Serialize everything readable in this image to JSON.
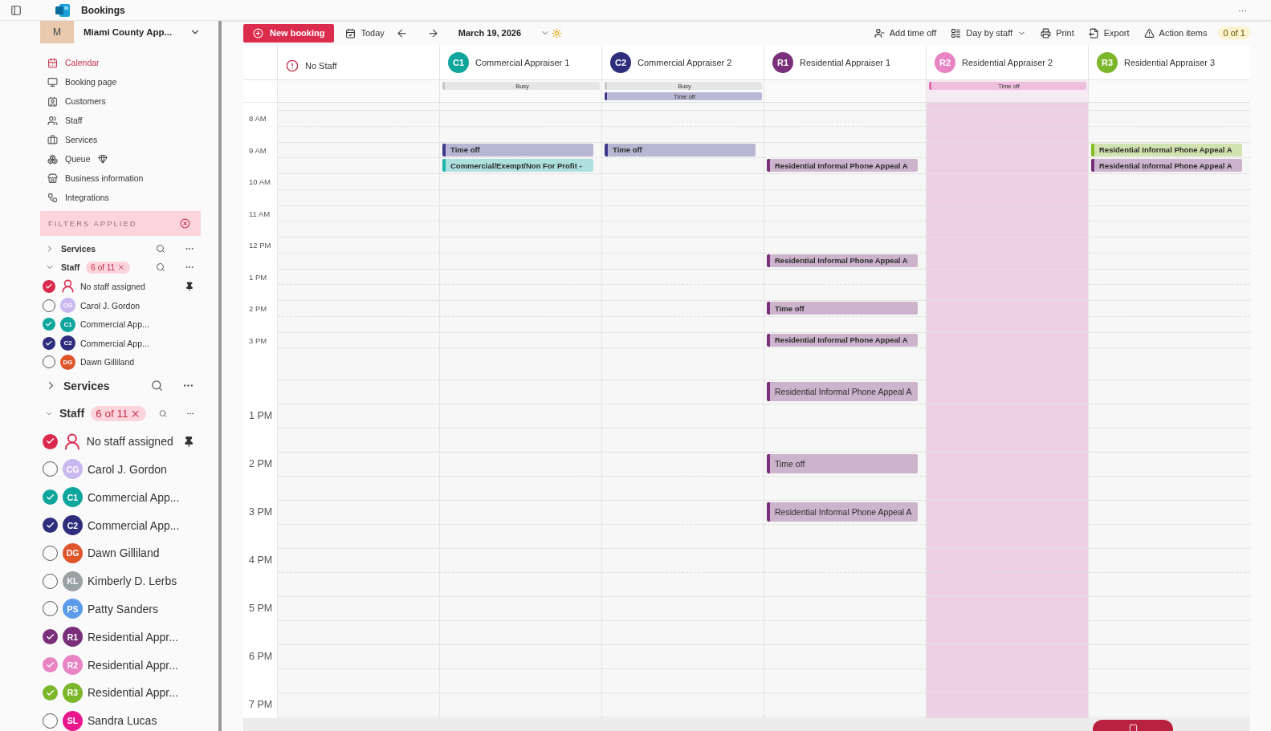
{
  "app": {
    "title": "Bookings",
    "more": "···"
  },
  "sidebar": {
    "org": {
      "initial": "M",
      "name": "Miami County App..."
    },
    "nav": [
      {
        "label": "Calendar",
        "selected": true,
        "premium": false
      },
      {
        "label": "Booking page",
        "selected": false,
        "premium": false
      },
      {
        "label": "Customers",
        "selected": false,
        "premium": false
      },
      {
        "label": "Staff",
        "selected": false,
        "premium": false
      },
      {
        "label": "Services",
        "selected": false,
        "premium": false
      },
      {
        "label": "Queue",
        "selected": false,
        "premium": true
      },
      {
        "label": "Business information",
        "selected": false,
        "premium": false
      },
      {
        "label": "Integrations",
        "selected": false,
        "premium": false
      }
    ],
    "filters_banner": "FILTERS APPLIED",
    "filter_panels": [
      {
        "kind": "compact",
        "services": {
          "label": "Services",
          "expanded": false
        },
        "staff": {
          "label": "Staff",
          "expanded": true,
          "badge": "6 of 11"
        },
        "members": [
          {
            "kind": "unassigned",
            "name": "No staff assigned",
            "checked": true,
            "color": "#d92a4d",
            "pinned": true
          },
          {
            "kind": "person",
            "initials": "CG",
            "name": "Carol J. Gordon",
            "checked": false,
            "color": "#c9b8f0",
            "pinned": false
          },
          {
            "kind": "person",
            "initials": "C1",
            "name": "Commercial App...",
            "checked": true,
            "color": "#0ea59c",
            "pinned": false
          },
          {
            "kind": "person",
            "initials": "C2",
            "name": "Commercial App...",
            "checked": true,
            "color": "#2f2e7c",
            "pinned": false
          },
          {
            "kind": "person",
            "initials": "DG",
            "name": "Dawn Gilliland",
            "checked": false,
            "color": "#e0562b",
            "pinned": false
          }
        ]
      },
      {
        "kind": "zoomed",
        "services": {
          "label": "Services",
          "expanded": false
        },
        "staff": {
          "label": "Staff",
          "expanded": true,
          "badge": "6 of 11"
        },
        "members": [
          {
            "kind": "unassigned",
            "name": "No staff assigned",
            "checked": true,
            "color": "#d92a4d",
            "pinned": true
          },
          {
            "kind": "person",
            "initials": "CG",
            "name": "Carol J. Gordon",
            "checked": false,
            "color": "#c9b8f0",
            "pinned": false
          },
          {
            "kind": "person",
            "initials": "C1",
            "name": "Commercial App...",
            "checked": true,
            "color": "#0ea59c",
            "pinned": false
          },
          {
            "kind": "person",
            "initials": "C2",
            "name": "Commercial App...",
            "checked": true,
            "color": "#2f2e7c",
            "pinned": false
          },
          {
            "kind": "person",
            "initials": "DG",
            "name": "Dawn Gilliland",
            "checked": false,
            "color": "#e0562b",
            "pinned": false
          },
          {
            "kind": "person",
            "initials": "KL",
            "name": "Kimberly D. Lerbs",
            "checked": false,
            "color": "#99a3a4",
            "pinned": false
          },
          {
            "kind": "person",
            "initials": "PS",
            "name": "Patty Sanders",
            "checked": false,
            "color": "#5b9bea",
            "pinned": false
          },
          {
            "kind": "person",
            "initials": "R1",
            "name": "Residential Appr...",
            "checked": true,
            "color": "#7a2f7a",
            "pinned": false
          },
          {
            "kind": "person",
            "initials": "R2",
            "name": "Residential Appr...",
            "checked": true,
            "color": "#e883c4",
            "pinned": false
          },
          {
            "kind": "person",
            "initials": "R3",
            "name": "Residential Appr...",
            "checked": true,
            "color": "#7cb62b",
            "pinned": false
          },
          {
            "kind": "person",
            "initials": "SL",
            "name": "Sandra Lucas",
            "checked": false,
            "color": "#e9168c",
            "pinned": false
          }
        ]
      }
    ]
  },
  "toolbar": {
    "new_booking": "New booking",
    "today": "Today",
    "date": "March 19, 2026",
    "actions": [
      "Add time off",
      "Day by staff",
      "Print",
      "Export",
      "Action items"
    ],
    "action_count": "0 of 1"
  },
  "calendar": {
    "columns": [
      {
        "kind": "unassigned",
        "label": "No Staff",
        "shaded": false
      },
      {
        "kind": "person",
        "initials": "C1",
        "label": "Commercial Appraiser 1",
        "color": "#0ea59c",
        "shaded": false,
        "all_day": [
          {
            "kind": "busy",
            "label": "Busy",
            "color": "#c8c8c8"
          }
        ]
      },
      {
        "kind": "person",
        "initials": "C2",
        "label": "Commercial Appraiser 2",
        "color": "#2f2e7c",
        "shaded": false,
        "all_day": [
          {
            "kind": "busy",
            "label": "Busy",
            "color": "#c8c8c8"
          },
          {
            "kind": "time-off",
            "label": "Time off",
            "color": "#3d3a8c"
          }
        ]
      },
      {
        "kind": "person",
        "initials": "R1",
        "label": "Residential Appraiser 1",
        "color": "#7a2f7a",
        "shaded": false
      },
      {
        "kind": "person",
        "initials": "R2",
        "label": "Residential Appraiser 2",
        "color": "#e883c4",
        "shaded": true,
        "all_day": [
          {
            "kind": "time-off",
            "label": "Time off",
            "color": "#e06bb0"
          }
        ]
      },
      {
        "kind": "person",
        "initials": "R3",
        "label": "Residential Appraiser 3",
        "color": "#7cb62b",
        "shaded": false
      }
    ],
    "blocks": [
      {
        "kind": "compact",
        "rows": [
          {
            "hour": "8 AM"
          },
          {
            "hour": "9 AM",
            "first": [
              {
                "kind": "free"
              },
              {
                "kind": "event",
                "label": "Time off",
                "color": "#3d3a8c"
              },
              {
                "kind": "event",
                "label": "Time off",
                "color": "#3d3a8c"
              },
              {
                "kind": "free"
              },
              {
                "kind": "free"
              },
              {
                "kind": "event",
                "label": "Residential Informal Phone Appeal A",
                "color": "#86bc25"
              }
            ],
            "second": [
              {
                "kind": "free"
              },
              {
                "kind": "event",
                "label": "Commercial/Exempt/Non For Profit -",
                "color": "#1fb5ad"
              },
              {
                "kind": "free"
              },
              {
                "kind": "event",
                "label": "Residential Informal Phone Appeal A",
                "color": "#7a2f7a"
              },
              {
                "kind": "free"
              },
              {
                "kind": "event",
                "label": "Residential Informal Phone Appeal A",
                "color": "#7a2f7a"
              }
            ]
          },
          {
            "hour": "10 AM"
          },
          {
            "hour": "11 AM"
          },
          {
            "hour": "12 PM",
            "second": [
              {
                "kind": "free"
              },
              {
                "kind": "free"
              },
              {
                "kind": "free"
              },
              {
                "kind": "event",
                "label": "Residential Informal Phone Appeal A",
                "color": "#7a2f7a"
              },
              {
                "kind": "free"
              },
              {
                "kind": "free"
              }
            ]
          },
          {
            "hour": "1 PM"
          },
          {
            "hour": "2 PM",
            "first": [
              {
                "kind": "free"
              },
              {
                "kind": "free"
              },
              {
                "kind": "free"
              },
              {
                "kind": "event",
                "label": "Time off",
                "color": "#7a2f7a"
              },
              {
                "kind": "free"
              },
              {
                "kind": "free"
              }
            ]
          },
          {
            "hour": "3 PM",
            "first": [
              {
                "kind": "free"
              },
              {
                "kind": "free"
              },
              {
                "kind": "free"
              },
              {
                "kind": "event",
                "label": "Residential Informal Phone Appeal A",
                "color": "#7a2f7a"
              },
              {
                "kind": "free"
              },
              {
                "kind": "free"
              }
            ]
          }
        ]
      },
      {
        "kind": "zoomed",
        "rows": [
          {
            "second": [
              {
                "kind": "free"
              },
              {
                "kind": "free"
              },
              {
                "kind": "free"
              },
              {
                "kind": "event",
                "label": "Residential Informal Phone Appeal A",
                "color": "#7a2f7a"
              },
              {
                "kind": "free"
              },
              {
                "kind": "free"
              }
            ]
          },
          {
            "hour": "1 PM"
          },
          {
            "hour": "2 PM",
            "first": [
              {
                "kind": "free"
              },
              {
                "kind": "free"
              },
              {
                "kind": "free"
              },
              {
                "kind": "event",
                "label": "Time off",
                "color": "#7a2f7a"
              },
              {
                "kind": "free"
              },
              {
                "kind": "free"
              }
            ]
          },
          {
            "hour": "3 PM",
            "first": [
              {
                "kind": "free"
              },
              {
                "kind": "free"
              },
              {
                "kind": "free"
              },
              {
                "kind": "event",
                "label": "Residential Informal Phone Appeal A",
                "color": "#7a2f7a"
              },
              {
                "kind": "free"
              },
              {
                "kind": "free"
              }
            ]
          },
          {
            "hour": "4 PM"
          },
          {
            "hour": "5 PM"
          },
          {
            "hour": "6 PM"
          },
          {
            "hour": "7 PM"
          }
        ]
      }
    ]
  }
}
